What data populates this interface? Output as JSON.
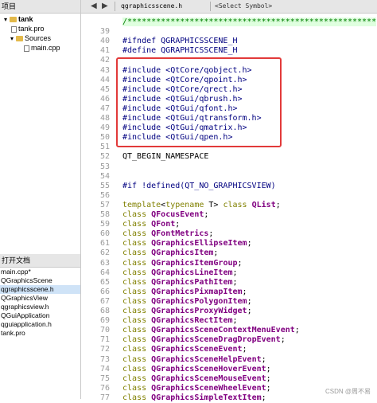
{
  "project_panel": {
    "title": "项目",
    "items": [
      {
        "label": "tank",
        "kind": "project",
        "expanded": true
      },
      {
        "label": "tank.pro",
        "kind": "file"
      },
      {
        "label": "Sources",
        "kind": "folder",
        "expanded": true
      },
      {
        "label": "main.cpp",
        "kind": "file"
      }
    ]
  },
  "open_documents": {
    "title": "打开文档",
    "items": [
      {
        "label": "main.cpp*"
      },
      {
        "label": "QGraphicsScene"
      },
      {
        "label": "qgraphicsscene.h",
        "selected": true
      },
      {
        "label": "QGraphicsView"
      },
      {
        "label": "qgraphicsview.h"
      },
      {
        "label": "QGuiApplication"
      },
      {
        "label": "qguiapplication.h"
      },
      {
        "label": "tank.pro"
      }
    ]
  },
  "toolbar": {
    "back": "◀",
    "forward": "▶",
    "file_name": "qgraphicsscene.h",
    "symbol": "<Select Symbol>"
  },
  "code_lines": [
    {
      "n": "",
      "t": "comment",
      "text": "/****************************************************"
    },
    {
      "n": "39",
      "t": "txt",
      "text": ""
    },
    {
      "n": "40",
      "t": "pp",
      "text": "#ifndef QGRAPHICSSCENE_H"
    },
    {
      "n": "41",
      "t": "pp",
      "text": "#define QGRAPHICSSCENE_H"
    },
    {
      "n": "42",
      "t": "txt",
      "text": ""
    },
    {
      "n": "43",
      "t": "pp",
      "text": "#include <QtCore/qobject.h>"
    },
    {
      "n": "44",
      "t": "pp",
      "text": "#include <QtCore/qpoint.h>"
    },
    {
      "n": "45",
      "t": "pp",
      "text": "#include <QtCore/qrect.h>"
    },
    {
      "n": "46",
      "t": "pp",
      "text": "#include <QtGui/qbrush.h>"
    },
    {
      "n": "47",
      "t": "pp",
      "text": "#include <QtGui/qfont.h>"
    },
    {
      "n": "48",
      "t": "pp",
      "text": "#include <QtGui/qtransform.h>"
    },
    {
      "n": "49",
      "t": "pp",
      "text": "#include <QtGui/qmatrix.h>"
    },
    {
      "n": "50",
      "t": "pp",
      "text": "#include <QtGui/qpen.h>"
    },
    {
      "n": "51",
      "t": "txt",
      "text": ""
    },
    {
      "n": "52",
      "t": "txt",
      "text": "QT_BEGIN_NAMESPACE"
    },
    {
      "n": "53",
      "t": "txt",
      "text": ""
    },
    {
      "n": "54",
      "t": "txt",
      "text": ""
    },
    {
      "n": "55",
      "t": "pp",
      "text": "#if !defined(QT_NO_GRAPHICSVIEW)"
    },
    {
      "n": "56",
      "t": "txt",
      "text": ""
    },
    {
      "n": "57",
      "t": "tmpl",
      "kw1": "template",
      "mid": "<",
      "kw2": "typename",
      "mid2": " T> ",
      "kw3": "class",
      "cls": "QList",
      "end": ";"
    },
    {
      "n": "58",
      "t": "decl",
      "kw": "class",
      "cls": "QFocusEvent",
      "end": ";"
    },
    {
      "n": "59",
      "t": "decl",
      "kw": "class",
      "cls": "QFont",
      "end": ";"
    },
    {
      "n": "60",
      "t": "decl",
      "kw": "class",
      "cls": "QFontMetrics",
      "end": ";"
    },
    {
      "n": "61",
      "t": "decl",
      "kw": "class",
      "cls": "QGraphicsEllipseItem",
      "end": ";"
    },
    {
      "n": "62",
      "t": "decl",
      "kw": "class",
      "cls": "QGraphicsItem",
      "end": ";"
    },
    {
      "n": "63",
      "t": "decl",
      "kw": "class",
      "cls": "QGraphicsItemGroup",
      "end": ";"
    },
    {
      "n": "64",
      "t": "decl",
      "kw": "class",
      "cls": "QGraphicsLineItem",
      "end": ";"
    },
    {
      "n": "65",
      "t": "decl",
      "kw": "class",
      "cls": "QGraphicsPathItem",
      "end": ";"
    },
    {
      "n": "66",
      "t": "decl",
      "kw": "class",
      "cls": "QGraphicsPixmapItem",
      "end": ";"
    },
    {
      "n": "67",
      "t": "decl",
      "kw": "class",
      "cls": "QGraphicsPolygonItem",
      "end": ";"
    },
    {
      "n": "68",
      "t": "decl",
      "kw": "class",
      "cls": "QGraphicsProxyWidget",
      "end": ";"
    },
    {
      "n": "69",
      "t": "decl",
      "kw": "class",
      "cls": "QGraphicsRectItem",
      "end": ";"
    },
    {
      "n": "70",
      "t": "decl",
      "kw": "class",
      "cls": "QGraphicsSceneContextMenuEvent",
      "end": ";"
    },
    {
      "n": "71",
      "t": "decl",
      "kw": "class",
      "cls": "QGraphicsSceneDragDropEvent",
      "end": ";"
    },
    {
      "n": "72",
      "t": "decl",
      "kw": "class",
      "cls": "QGraphicsSceneEvent",
      "end": ";"
    },
    {
      "n": "73",
      "t": "decl",
      "kw": "class",
      "cls": "QGraphicsSceneHelpEvent",
      "end": ";"
    },
    {
      "n": "74",
      "t": "decl",
      "kw": "class",
      "cls": "QGraphicsSceneHoverEvent",
      "end": ";"
    },
    {
      "n": "75",
      "t": "decl",
      "kw": "class",
      "cls": "QGraphicsSceneMouseEvent",
      "end": ";"
    },
    {
      "n": "76",
      "t": "decl",
      "kw": "class",
      "cls": "QGraphicsSceneWheelEvent",
      "end": ";"
    },
    {
      "n": "77",
      "t": "decl",
      "kw": "class",
      "cls": "QGraphicsSimpleTextItem",
      "end": ";"
    }
  ],
  "watermark": "CSDN @周不易",
  "colors": {
    "highlight_box": "#e23a3a",
    "keyword": "#808000",
    "class_name": "#800080",
    "preprocessor": "#000080",
    "comment": "#008000"
  }
}
